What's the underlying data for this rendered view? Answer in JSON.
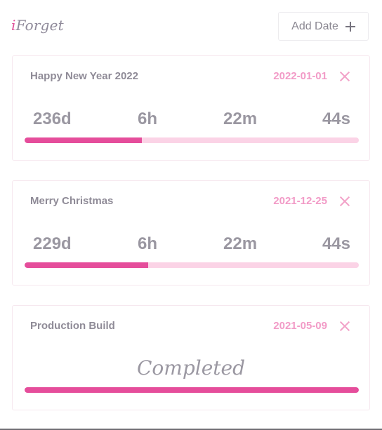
{
  "app": {
    "logo_accent": "i",
    "logo_rest": "Forget",
    "add_button_label": "Add Date",
    "add_icon": "plus-icon",
    "close_icon": "close-icon"
  },
  "colors": {
    "accent": "#e54d9b",
    "accent_light": "#fbd3e6",
    "date_text": "#f29bc7",
    "muted_text": "#8f8b97"
  },
  "cards": [
    {
      "title": "Happy New Year 2022",
      "date": "2022-01-01",
      "days": "236d",
      "hours": "6h",
      "minutes": "22m",
      "seconds": "44s",
      "progress": 0.35
    },
    {
      "title": "Merry Christmas",
      "date": "2021-12-25",
      "days": "229d",
      "hours": "6h",
      "minutes": "22m",
      "seconds": "44s",
      "progress": 0.37
    },
    {
      "title": "Production Build",
      "date": "2021-05-09",
      "completed_text": "Completed",
      "progress": 1.0
    }
  ]
}
